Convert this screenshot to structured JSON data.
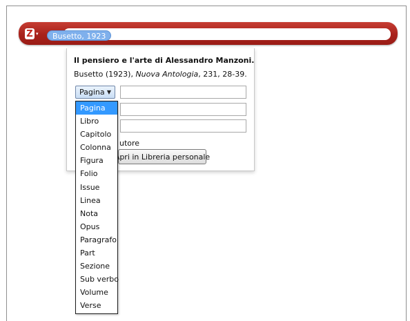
{
  "zotero_bar": {
    "logo_letter": "Z",
    "caret": "▾",
    "citation": "Busetto, 1923"
  },
  "reference": {
    "title": "Il pensiero e l'arte di Alessandro Manzoni.",
    "author_year": "Busetto (1923), ",
    "journal": "Nuova Antologia",
    "details": ", 231, 28-39."
  },
  "locator": {
    "selected": "Pagina",
    "caret": "▼",
    "options": [
      "Pagina",
      "Libro",
      "Capitolo",
      "Colonna",
      "Figura",
      "Folio",
      "Issue",
      "Linea",
      "Nota",
      "Opus",
      "Paragrafo",
      "Part",
      "Sezione",
      "Sub verbo",
      "Volume",
      "Verse"
    ]
  },
  "form": {
    "suppress_author_label_visible": "utore",
    "open_button": "Apri in Libreria personale"
  },
  "colors": {
    "bar": "#b02a21",
    "bubble": "#7fb0ec",
    "selected_option": "#3399ff"
  }
}
